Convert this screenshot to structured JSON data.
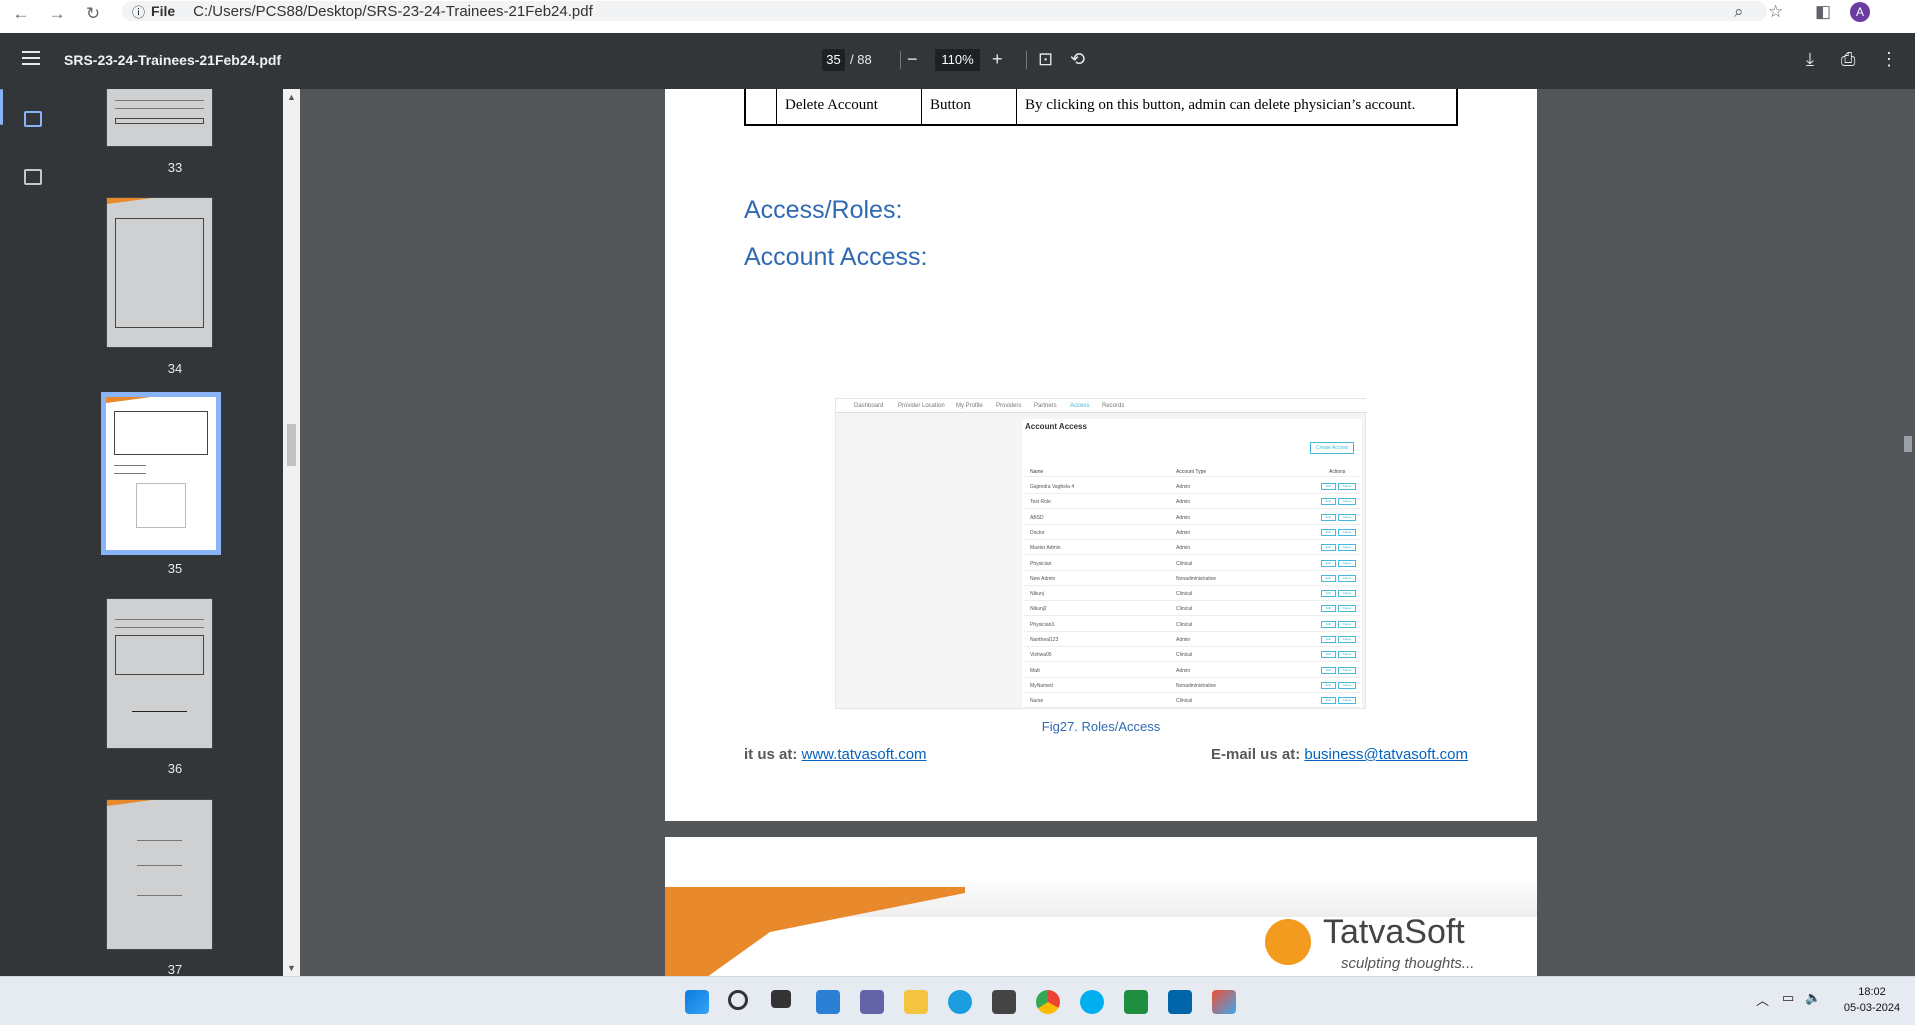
{
  "browser": {
    "chip": "File",
    "url": "C:/Users/PCS88/Desktop/SRS-23-24-Trainees-21Feb24.pdf",
    "avatar": "A"
  },
  "toolbar": {
    "title": "SRS-23-24-Trainees-21Feb24.pdf",
    "page_current": "35",
    "page_total": "/ 88",
    "zoom": "110%"
  },
  "thumbnails": [
    {
      "num": "33"
    },
    {
      "num": "34"
    },
    {
      "num": "35"
    },
    {
      "num": "36"
    },
    {
      "num": "37"
    }
  ],
  "document": {
    "table_row": {
      "name": "Delete Account",
      "type": "Button",
      "desc": "By clicking on this button, admin can delete physician’s account."
    },
    "heading_roles": "Access/Roles:",
    "heading_account": "Account Access:",
    "figure": {
      "tabs": [
        "Dashboard",
        "Provider Location",
        "My Profile",
        "Providers",
        "Partners",
        "Access",
        "Records"
      ],
      "title": "Account Access",
      "create_button": "Create Access",
      "headers": {
        "name": "Name",
        "type": "Account Type",
        "actions": "Actions"
      },
      "edit_label": "Edit",
      "delete_label": "Delete",
      "rows": [
        {
          "name": "Gajendra Vaghela 4",
          "type": "Admin"
        },
        {
          "name": "Test Role",
          "type": "Admin"
        },
        {
          "name": "ABSD",
          "type": "Admin"
        },
        {
          "name": "Doctor",
          "type": "Admin"
        },
        {
          "name": "Master Admin",
          "type": "Admin"
        },
        {
          "name": "Physician",
          "type": "Clinical"
        },
        {
          "name": "New Admin",
          "type": "Nonadministrative"
        },
        {
          "name": "Nikunj",
          "type": "Clinical"
        },
        {
          "name": "Nikunj2",
          "type": "Clinical"
        },
        {
          "name": "Physician3",
          "type": "Clinical"
        },
        {
          "name": "Nantheal123",
          "type": "Admin"
        },
        {
          "name": "Vishwa05",
          "type": "Clinical"
        },
        {
          "name": "Matt",
          "type": "Admin"
        },
        {
          "name": "MyNamed",
          "type": "Nonadministrative"
        },
        {
          "name": "Nurse",
          "type": "Clinical"
        }
      ]
    },
    "caption": "Fig27. Roles/Access",
    "footer_left_prefix": "it us at: ",
    "footer_left_link": "www.tatvasoft.com",
    "footer_right_prefix": "E-mail us at: ",
    "footer_right_link": "business@tatvasoft.com",
    "logo_name": "TatvaSoft",
    "logo_tag": "sculpting thoughts..."
  },
  "taskbar": {
    "time": "18:02",
    "date": "05-03-2024"
  },
  "colors": {
    "accent": "#8ab4f8",
    "heading": "#2f6ab3",
    "orange": "#e8892b"
  }
}
